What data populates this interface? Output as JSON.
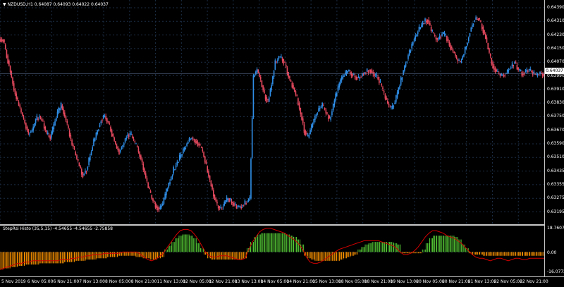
{
  "symbol_header": "NZDUSD,H1  0.64087 0.64093 0.64022 0.64037",
  "indicator_header": "StepRsi Histo (35,5,15) -4.54655 -4.54655 -2.75858",
  "price_scale": [
    "0.64390",
    "0.64310",
    "0.64230",
    "0.64150",
    "0.64070",
    "0.63990",
    "0.63910",
    "0.63830",
    "0.63750",
    "0.63670",
    "0.63590",
    "0.63510",
    "0.63435",
    "0.63355",
    "0.63275",
    "0.63195"
  ],
  "current_price": "0.64037",
  "indicator_scale": [
    "18.76071",
    "0.00",
    "-16.07722"
  ],
  "time_labels": [
    "5 Nov 2019",
    "6 Nov 05:00",
    "6 Nov 21:00",
    "7 Nov 13:00",
    "8 Nov 05:00",
    "8 Nov 21:00",
    "11 Nov 13:00",
    "12 Nov 05:00",
    "12 Nov 21:00",
    "13 Nov 13:00",
    "14 Nov 05:00",
    "14 Nov 21:00",
    "15 Nov 13:00",
    "18 Nov 05:00",
    "18 Nov 21:00",
    "19 Nov 13:00",
    "20 Nov 05:00",
    "20 Nov 21:00",
    "21 Nov 13:00",
    "22 Nov 05:00",
    "22 Nov 21:00"
  ],
  "colors": {
    "bull": "#2f8fe8",
    "bear": "#e84a5f",
    "hist_up": "#52c234",
    "hist_down": "#f08c00",
    "signal": "#d10000",
    "grid": "#1c2d44"
  },
  "chart_data": {
    "type": "candlestick",
    "series": [
      {
        "values": [
          0.6423,
          0.6414,
          0.6405,
          0.6395,
          0.6388,
          0.6382,
          0.6376,
          0.637,
          0.6372,
          0.6378,
          0.638,
          0.6376,
          0.637,
          0.6368,
          0.6375,
          0.6382,
          0.6386,
          0.638,
          0.6372,
          0.6364,
          0.6358,
          0.6352,
          0.6347,
          0.635,
          0.6358,
          0.6366,
          0.6372,
          0.6378,
          0.638,
          0.6376,
          0.637,
          0.6364,
          0.636,
          0.6364,
          0.6369,
          0.637,
          0.6366,
          0.6362,
          0.6356,
          0.6348,
          0.634,
          0.6334,
          0.633,
          0.6328,
          0.6331,
          0.6338,
          0.6344,
          0.635,
          0.6354,
          0.6358,
          0.6362,
          0.6366,
          0.6368,
          0.6366,
          0.6364,
          0.636,
          0.6352,
          0.6344,
          0.6336,
          0.633,
          0.6328,
          0.6331,
          0.6334,
          0.6332,
          0.633,
          0.6329,
          0.633,
          0.6332,
          0.6334,
          0.6402,
          0.6406,
          0.64,
          0.6392,
          0.6388,
          0.6398,
          0.641,
          0.6413,
          0.6412,
          0.6407,
          0.64,
          0.6396,
          0.639,
          0.6382,
          0.6372,
          0.6368,
          0.6374,
          0.638,
          0.6384,
          0.6386,
          0.6382,
          0.6378,
          0.6386,
          0.6394,
          0.64,
          0.6403,
          0.6405,
          0.6404,
          0.6402,
          0.6401,
          0.6403,
          0.6405,
          0.6406,
          0.6404,
          0.6402,
          0.6398,
          0.6392,
          0.6387,
          0.6384,
          0.6388,
          0.6395,
          0.6403,
          0.641,
          0.6416,
          0.6422,
          0.6426,
          0.643,
          0.6433,
          0.6434,
          0.6428,
          0.6424,
          0.6423,
          0.6426,
          0.6425,
          0.642,
          0.6416,
          0.6412,
          0.641,
          0.6415,
          0.6422,
          0.643,
          0.6434,
          0.6435,
          0.643,
          0.6424,
          0.6415,
          0.6408,
          0.6405,
          0.6403,
          0.6403,
          0.6405,
          0.6408,
          0.641,
          0.6406,
          0.6404,
          0.6405,
          0.6406,
          0.6404,
          0.6403,
          0.6404,
          0.64037
        ]
      }
    ],
    "ylim": [
      0.63195,
      0.6445
    ],
    "indicator": {
      "name": "StepRsi Histo (35,5,15)",
      "ylim": [
        -16.07722,
        18.76071
      ],
      "histogram": [
        -14,
        -13,
        -13,
        -12,
        -12,
        -11,
        -11,
        -10,
        -10,
        -10,
        -10,
        -9,
        -9,
        -9,
        -9,
        -9,
        -9,
        -9,
        -8,
        -8,
        -8,
        -7,
        -7,
        -7,
        -6,
        -6,
        -6,
        -5,
        -5,
        -5,
        -4,
        -4,
        -4,
        -3,
        -3,
        -3,
        -3,
        -3,
        -4,
        -4,
        -5,
        -5,
        -6,
        -6,
        -5,
        -4,
        2,
        5,
        8,
        11,
        13,
        14,
        14,
        13,
        11,
        7,
        3,
        -2,
        -5,
        -6,
        -6,
        -6,
        -6,
        -6,
        -6,
        -6,
        -6,
        -6,
        -5,
        3,
        8,
        12,
        14,
        15,
        15,
        15,
        15,
        15,
        15,
        15,
        14,
        13,
        12,
        10,
        6,
        -3,
        -5,
        -6,
        -7,
        -7,
        -7,
        -7,
        -7,
        -7,
        -7,
        -6,
        -5,
        -4,
        -3,
        -2,
        2,
        4,
        6,
        7,
        8,
        8,
        8,
        8,
        8,
        8,
        7,
        6,
        -1,
        -1,
        -1,
        -1,
        -1,
        -1,
        2,
        7,
        11,
        13,
        13,
        13,
        13,
        13,
        13,
        12,
        10,
        6,
        3,
        -1,
        -2,
        -2,
        -2,
        -3,
        -3,
        -3,
        -3,
        -3,
        -3,
        -3,
        -3,
        -3,
        -3,
        -3,
        -3,
        -3,
        -3,
        -3,
        -3,
        -3
      ],
      "signal": [
        -14,
        -13,
        -12,
        -11,
        -10,
        -9,
        -9,
        -8,
        -8,
        -7,
        -7,
        -7,
        -7,
        -7,
        -7,
        -7,
        -7,
        -6,
        -6,
        -6,
        -5,
        -5,
        -4,
        -4,
        -3,
        -3,
        -2,
        -2,
        -2,
        -1,
        -1,
        -1,
        -1,
        -1,
        0,
        0,
        0,
        0,
        0,
        -2,
        -4,
        -6,
        -7,
        -6,
        -4,
        -2,
        2,
        6,
        10,
        14,
        17,
        18,
        18,
        17,
        14,
        10,
        5,
        0,
        -3,
        -4,
        -4,
        -3,
        -3,
        -3,
        -4,
        -5,
        -6,
        -6,
        -5,
        2,
        8,
        12,
        16,
        18,
        19,
        19,
        18,
        17,
        16,
        15,
        13,
        11,
        9,
        6,
        2,
        -4,
        -8,
        -9,
        -9,
        -8,
        -6,
        -4,
        -2,
        0,
        2,
        3,
        4,
        5,
        6,
        7,
        8,
        9,
        9,
        9,
        9,
        9,
        8,
        7,
        6,
        5,
        3,
        0,
        -2,
        -2,
        -1,
        1,
        4,
        8,
        12,
        15,
        17,
        17,
        16,
        15,
        13,
        12,
        11,
        9,
        7,
        4,
        1,
        -2,
        -4,
        -5,
        -5,
        -6,
        -7,
        -6,
        -5,
        -5,
        -6,
        -7,
        -6,
        -5,
        -5,
        -6,
        -6,
        -5,
        -5,
        -5,
        -5,
        -5
      ]
    }
  }
}
